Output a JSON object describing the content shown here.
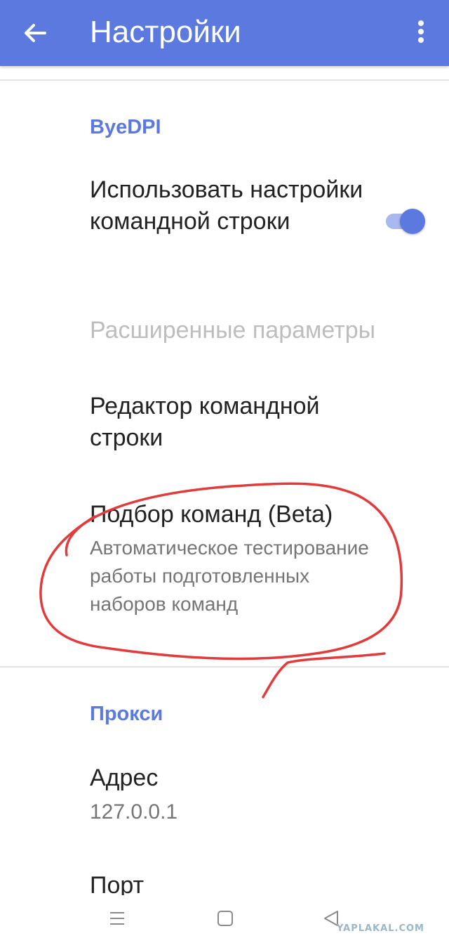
{
  "app_bar": {
    "title": "Настройки",
    "back_icon": "arrow-left-icon",
    "more_icon": "more-vert-icon",
    "color": "#5b79df"
  },
  "sections": {
    "byedpi": {
      "title": "ByeDPI",
      "use_cmd": {
        "title": "Использовать настройки командной строки",
        "toggle_on": true
      },
      "advanced": {
        "title": "Расширенные параметры"
      },
      "cmd_editor": {
        "title": "Редактор командной строки"
      },
      "cmd_selection": {
        "title": "Подбор команд (Beta)",
        "summary": "Автоматическое тестирование работы подготовленных наборов команд"
      }
    },
    "proxy": {
      "title": "Прокси",
      "address": {
        "title": "Адрес",
        "value": "127.0.0.1"
      },
      "port": {
        "title": "Порт"
      }
    }
  },
  "nav": {
    "menu_icon": "menu-icon",
    "home_icon": "home-square-icon",
    "back_icon": "triangle-back-icon"
  },
  "watermark": "YAPLAKAL.COM",
  "colors": {
    "accent": "#5b79df",
    "annotation": "#e23b3b"
  }
}
